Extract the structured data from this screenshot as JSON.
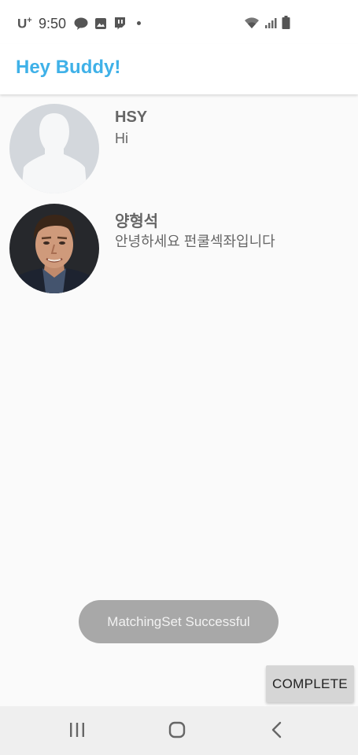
{
  "status_bar": {
    "carrier": "U",
    "carrier_sup": "+",
    "time": "9:50",
    "notification_icons": [
      "talk-icon",
      "image-icon",
      "twitch-icon",
      "dot-icon"
    ],
    "system_icons": [
      "wifi-icon",
      "signal-icon",
      "battery-icon"
    ]
  },
  "app_bar": {
    "title": "Hey Buddy!",
    "title_color": "#3fb1e8"
  },
  "chats": [
    {
      "name": "HSY",
      "message": "Hi",
      "avatar": "default-person-avatar"
    },
    {
      "name": "양형석",
      "message": "안녕하세요 펀쿨섹좌입니다",
      "avatar": "photo-avatar"
    }
  ],
  "toast": {
    "text": "MatchingSet Successful"
  },
  "complete_button": {
    "label": "COMPLETE"
  },
  "nav_bar": {
    "buttons": [
      "recent-apps-icon",
      "home-icon",
      "back-icon"
    ]
  }
}
